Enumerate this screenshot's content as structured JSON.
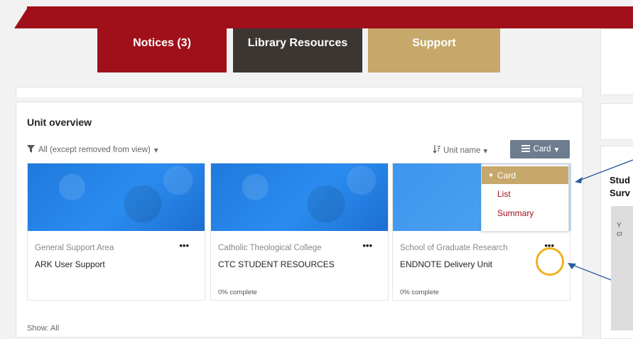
{
  "tabs": {
    "notices": "Notices (3)",
    "library": "Library Resources",
    "support": "Support"
  },
  "unit_overview": {
    "title": "Unit overview",
    "filter_label": "All (except removed from view)",
    "sort_label": "Unit name",
    "view_button": "Card",
    "dropdown": {
      "card": "Card",
      "list": "List",
      "summary": "Summary"
    },
    "show_label": "Show: All"
  },
  "cards": [
    {
      "category": "General Support Area",
      "name": "ARK User Support",
      "progress": ""
    },
    {
      "category": "Catholic Theological College",
      "name": "CTC STUDENT RESOURCES",
      "progress": "0% complete"
    },
    {
      "category": "School of Graduate Research",
      "name": "ENDNOTE Delivery Unit",
      "progress": "0% complete"
    }
  ],
  "right_panel": {
    "line1": "Stud",
    "line2": "Surv",
    "small1": "Y",
    "small2": "cr"
  },
  "icons": {
    "filter": "filter-icon",
    "sort": "sort-icon",
    "card_view": "card-view-icon",
    "chevron": "chevron-down-icon",
    "menu": "more-dots-icon",
    "callout": "arrow-icon"
  },
  "colors": {
    "brand_red": "#a0101a",
    "dark_tab": "#3b3632",
    "gold_tab": "#c6a86b",
    "highlight": "#f2b01e",
    "arrow": "#2b5a9e"
  }
}
